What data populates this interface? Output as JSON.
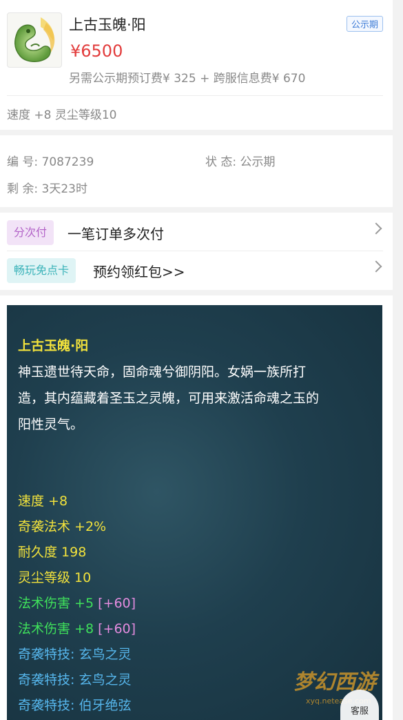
{
  "product": {
    "name": "上古玉魄·阳",
    "price": "¥6500",
    "fees": "另需公示期预订费¥ 325 + 跨服信息费¥ 670",
    "badge": "公示期",
    "summary": "速度 +8 灵尘等级10",
    "thumbnail_icon": "jade-dragon-icon"
  },
  "info": {
    "id_label": "编 号:",
    "id_value": "7087239",
    "status_label": "状 态:",
    "status_value": "公示期",
    "remaining_label": "剩 余:",
    "remaining_value": "3天23时"
  },
  "payment": {
    "installment_tag": "分次付",
    "installment_text": "一笔订单多次付",
    "card_tag": "畅玩免点卡",
    "card_text": "预约领红包>>"
  },
  "description": {
    "title": "上古玉魄·阳",
    "lines": [
      "神玉遗世待天命，固命魂兮御阴阳。女娲一族所打",
      "造，其内蕴藏着圣玉之灵魄，可用来激活命魂之玉的",
      "阳性灵气。"
    ],
    "attributes": {
      "speed": "速度 +8",
      "surprise_magic": "奇袭法术 +2%",
      "durability": "耐久度 198",
      "dust_level": "灵尘等级 10",
      "magic_damage_1": "法术伤害 +5",
      "magic_damage_1_bonus": "[+60]",
      "magic_damage_2": "法术伤害 +8",
      "magic_damage_2_bonus": "[+60]",
      "skill_1": "奇袭特技: 玄鸟之灵",
      "skill_2": "奇袭特技: 玄鸟之灵",
      "skill_3": "奇袭特技: 伯牙绝弦"
    }
  },
  "watermark": {
    "logo_text": "梦幻西游",
    "logo_sub": "xyq.netease.com",
    "service_label": "客服"
  },
  "colors": {
    "price": "#e23c3c",
    "panel_bg": "#1f3f4e",
    "yellow": "#f2e23c",
    "green": "#3fe05b",
    "blue": "#56b6ec",
    "pink": "#e58ce0"
  }
}
